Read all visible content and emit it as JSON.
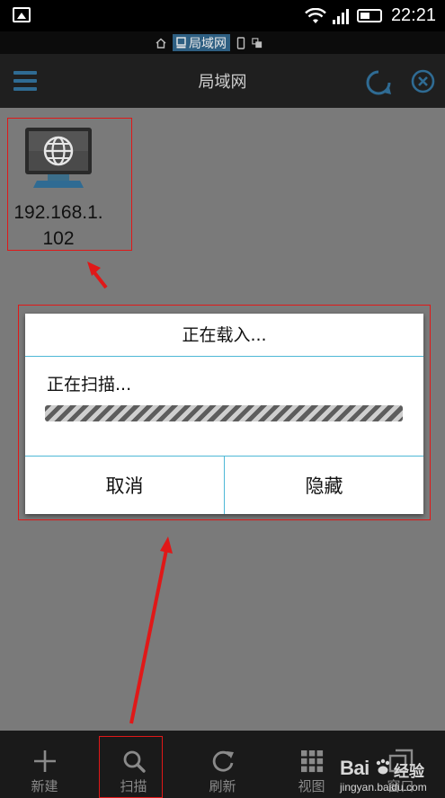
{
  "status_bar": {
    "time": "22:21"
  },
  "breadcrumb": {
    "current": "局域网"
  },
  "title_bar": {
    "title": "局域网"
  },
  "device": {
    "label": "192.168.1.102",
    "label_line1": "192.168.1.",
    "label_line2": "102"
  },
  "dialog": {
    "title": "正在载入...",
    "message": "正在扫描...",
    "cancel_label": "取消",
    "hide_label": "隐藏"
  },
  "toolbar": {
    "items": [
      {
        "label": "新建",
        "icon": "plus-icon"
      },
      {
        "label": "扫描",
        "icon": "search-icon"
      },
      {
        "label": "刷新",
        "icon": "refresh-icon"
      },
      {
        "label": "视图",
        "icon": "grid-icon"
      },
      {
        "label": "窗口",
        "icon": "windows-icon"
      }
    ]
  },
  "watermark": {
    "brand": "Bai",
    "brand_suffix": "经验",
    "url": "jingyan.baidu.com"
  },
  "colors": {
    "accent": "#4eb8d6",
    "annotation": "#e01818",
    "titlebar": "#1f1f1f",
    "breadcrumb_active": "#2e5f82"
  }
}
